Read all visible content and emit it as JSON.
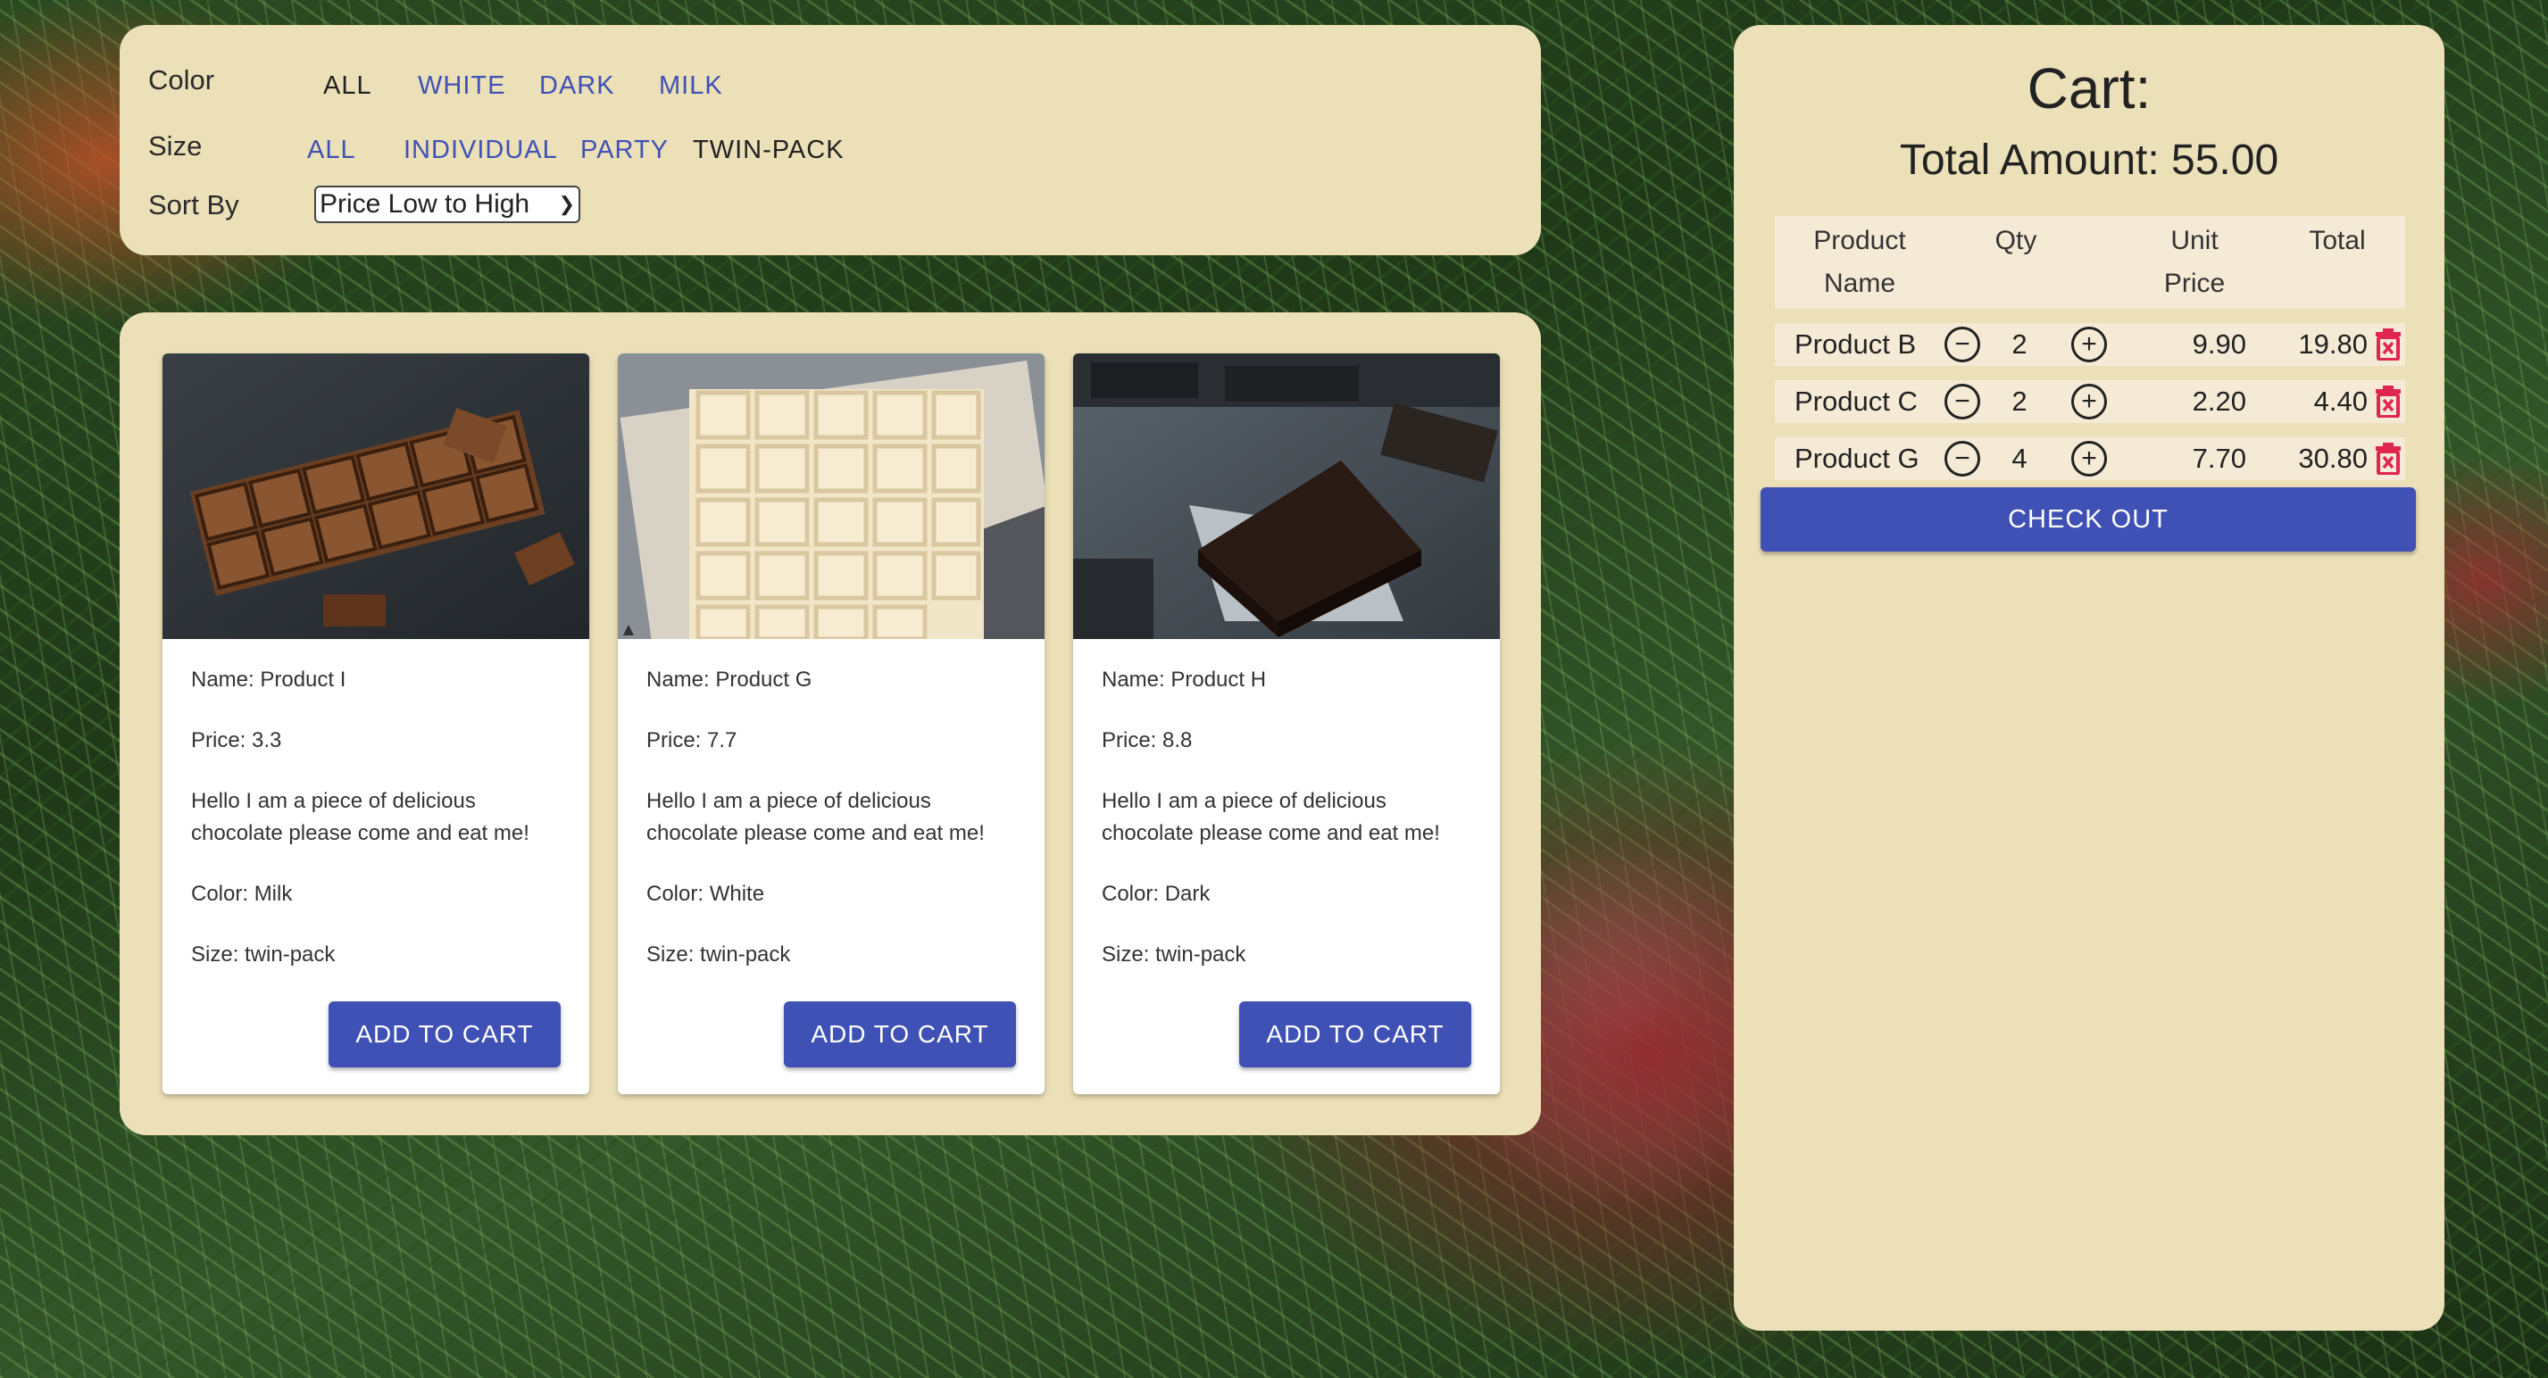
{
  "filters": {
    "color_label": "Color",
    "color_options": [
      "ALL",
      "WHITE",
      "DARK",
      "MILK"
    ],
    "color_selected": "ALL",
    "size_label": "Size",
    "size_options": [
      "ALL",
      "INDIVIDUAL",
      "PARTY",
      "TWIN-PACK"
    ],
    "size_selected": "TWIN-PACK",
    "sort_label": "Sort By",
    "sort_value": "Price Low to High"
  },
  "products": [
    {
      "name": "Name: Product I",
      "price": "Price: 3.3",
      "desc1": "Hello I am a piece of delicious",
      "desc2": "chocolate please come and eat me!",
      "color": "Color: Milk",
      "size": "Size: twin-pack",
      "button": "ADD TO CART"
    },
    {
      "name": "Name: Product G",
      "price": "Price: 7.7",
      "desc1": "Hello I am a piece of delicious",
      "desc2": "chocolate please come and eat me!",
      "color": "Color: White",
      "size": "Size: twin-pack",
      "button": "ADD TO CART"
    },
    {
      "name": "Name: Product H",
      "price": "Price: 8.8",
      "desc1": "Hello I am a piece of delicious",
      "desc2": "chocolate please come and eat me!",
      "color": "Color: Dark",
      "size": "Size: twin-pack",
      "button": "ADD TO CART"
    }
  ],
  "cart": {
    "title": "Cart:",
    "total": "Total Amount: 55.00",
    "headers": {
      "product_1": "Product",
      "product_2": "Name",
      "qty": "Qty",
      "unit_1": "Unit",
      "unit_2": "Price",
      "total": "Total"
    },
    "rows": [
      {
        "name": "Product B",
        "qty": "2",
        "unit": "9.90",
        "total": "19.80"
      },
      {
        "name": "Product C",
        "qty": "2",
        "unit": "2.20",
        "total": "4.40"
      },
      {
        "name": "Product G",
        "qty": "4",
        "unit": "7.70",
        "total": "30.80"
      }
    ],
    "checkout": "CHECK OUT"
  },
  "colors": {
    "panel": "#ece0b8",
    "accent": "#3f51b5",
    "delete": "#e0264f"
  },
  "icons": [
    "minus-circle-icon",
    "plus-circle-icon",
    "trash-icon",
    "dropdown-chevron-icon"
  ]
}
